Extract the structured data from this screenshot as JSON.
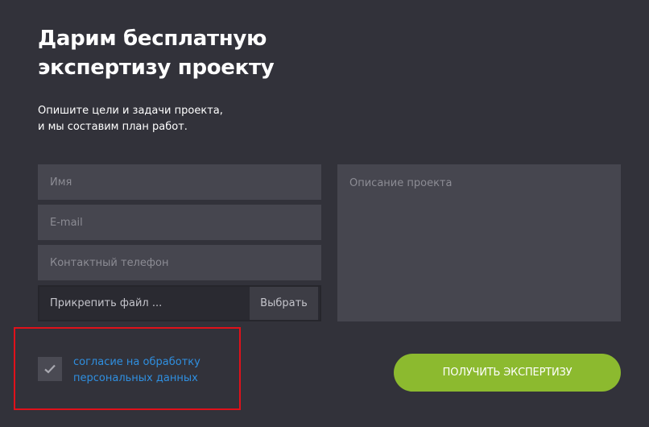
{
  "header": {
    "title_line1": "Дарим бесплатную",
    "title_line2": "экспертизу проекту",
    "subtitle_line1": "Опишите цели и задачи проекта,",
    "subtitle_line2": "и мы составим план работ."
  },
  "form": {
    "name_placeholder": "Имя",
    "email_placeholder": "E-mail",
    "phone_placeholder": "Контактный телефон",
    "file_label": "Прикрепить файл ...",
    "file_button": "Выбрать",
    "description_placeholder": "Описание проекта",
    "consent_line1": "согласие на обработку",
    "consent_line2": "персональных данных",
    "consent_checked": true,
    "submit_label": "ПОЛУЧИТЬ ЭКСПЕРТИЗУ"
  },
  "colors": {
    "background": "#32323a",
    "field": "#46464f",
    "accent_green": "#8cba2f",
    "link_blue": "#2f8fe0",
    "highlight_red": "#e0111a"
  },
  "icons": {
    "checkbox": "check-icon"
  }
}
